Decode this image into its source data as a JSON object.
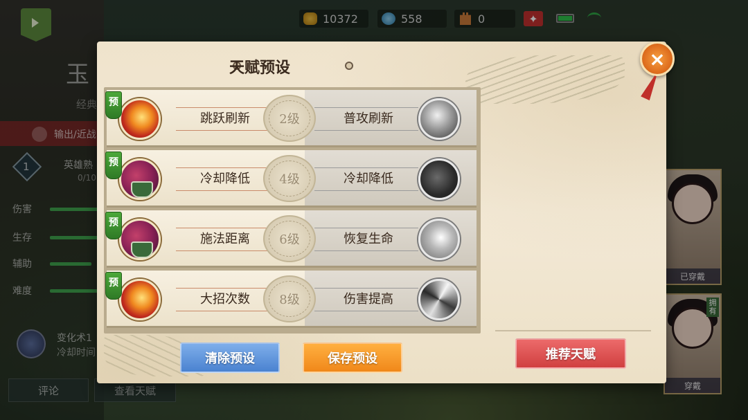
{
  "status_bar": {
    "gold": "10372",
    "gems": "558",
    "tower": "0",
    "badge": "✦"
  },
  "background": {
    "hero_title": "玉",
    "hero_sub": "经典",
    "role": "输出/近战",
    "level": "1",
    "familiarity_label": "英雄熟",
    "familiarity_value": "0/10",
    "stats": [
      {
        "label": "伤害",
        "value": 0.7
      },
      {
        "label": "生存",
        "value": 0.7
      },
      {
        "label": "辅助",
        "value": 0.6
      },
      {
        "label": "难度",
        "value": 0.7
      }
    ],
    "skill_name": "变化术1",
    "skill_desc": "冷却时间",
    "comment_btn": "评论",
    "view_talent_btn": "查看天赋",
    "card_worn_label": "已穿戴",
    "card_wear_label": "穿戴",
    "owned_tag": "拥有"
  },
  "modal": {
    "title": "天赋预设",
    "close_label": "×",
    "preset_tag": "预",
    "rows": [
      {
        "left": "跳跃刷新",
        "level": "2级",
        "right": "普攻刷新",
        "left_icon": "fire-talent-icon",
        "right_icon": "punch-talent-icon"
      },
      {
        "left": "冷却降低",
        "level": "4级",
        "right": "冷却降低",
        "left_icon": "potion-talent-icon",
        "right_icon": "pot-talent-icon"
      },
      {
        "left": "施法距离",
        "level": "6级",
        "right": "恢复生命",
        "left_icon": "potion-talent-icon",
        "right_icon": "heal-talent-icon"
      },
      {
        "left": "大招次数",
        "level": "8级",
        "right": "伤害提高",
        "left_icon": "fire-talent-icon",
        "right_icon": "swirl-talent-icon"
      }
    ],
    "clear_btn": "清除预设",
    "save_btn": "保存预设",
    "recommend_btn": "推荐天赋"
  },
  "colors": {
    "modal_bg": "#f3e9d6",
    "clear_btn": "#5a90db",
    "save_btn": "#f7981f",
    "recommend_btn": "#dd5050",
    "preset_tag": "#3e9630"
  }
}
